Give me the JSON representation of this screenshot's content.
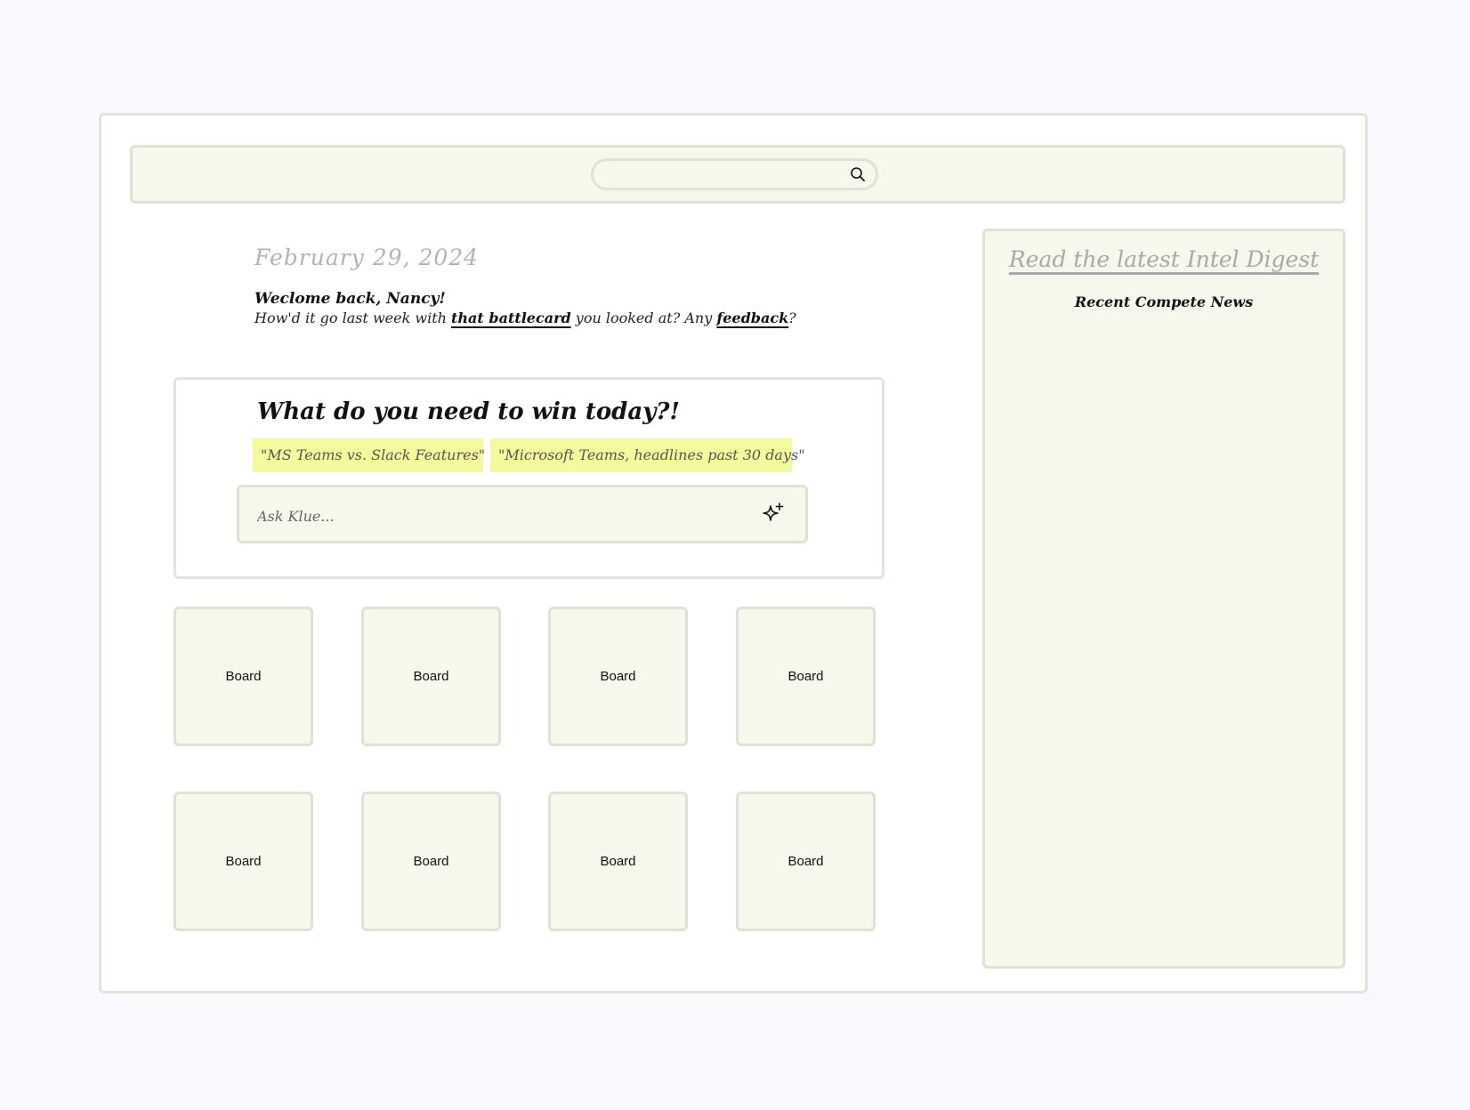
{
  "search": {
    "value": "",
    "icon": "search-icon"
  },
  "greeting": {
    "date": "February 29, 2024",
    "welcome": "Weclome back, Nancy!",
    "question_prefix": "How'd it go last week with ",
    "battlecard_link": "that battlecard",
    "question_middle": " you looked at?  Any ",
    "feedback_link": "feedback",
    "question_suffix": "?"
  },
  "ask": {
    "heading": "What do you need to win today?!",
    "suggestions": [
      "\"MS Teams vs. Slack Features\"",
      "\"Microsoft Teams, headlines past 30 days\""
    ],
    "placeholder": "Ask Klue...",
    "icon": "sparkle-icon"
  },
  "boards": [
    {
      "label": "Board"
    },
    {
      "label": "Board"
    },
    {
      "label": "Board"
    },
    {
      "label": "Board"
    },
    {
      "label": "Board"
    },
    {
      "label": "Board"
    },
    {
      "label": "Board"
    },
    {
      "label": "Board"
    }
  ],
  "sidebar": {
    "digest_link": "Read the latest Intel Digest",
    "news_title": "Recent Compete News"
  },
  "colors": {
    "page_background": "#f8f9fd",
    "panel_fill": "#f7f8ec",
    "panel_border": "#dfe1d2",
    "chip_highlight": "#f4fa9c",
    "muted_text": "#b3b3b3"
  }
}
